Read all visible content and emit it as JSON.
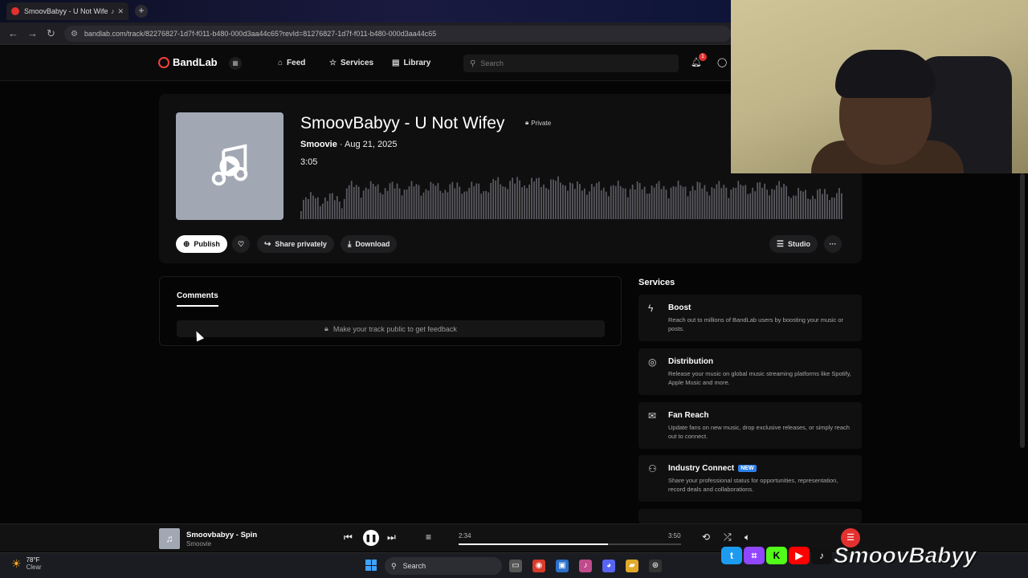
{
  "browser": {
    "tab_title": "SmoovBabyy - U Not Wife",
    "new_tab_symbol": "+",
    "url": "bandlab.com/track/82276827-1d7f-f011-b480-000d3aa44c65?revId=81276827-1d7f-f011-b480-000d3aa44c65"
  },
  "header": {
    "brand": "BandLab",
    "nav": [
      {
        "label": "Feed",
        "icon": "home-icon"
      },
      {
        "label": "Services",
        "icon": "star-icon"
      },
      {
        "label": "Library",
        "icon": "library-icon"
      }
    ],
    "search_placeholder": "Search",
    "notification_count": "1"
  },
  "track": {
    "title": "SmoovBabyy - U Not Wifey",
    "visibility": "Private",
    "artist": "Smoovie",
    "date": "· Aug 21, 2025",
    "duration": "3:05",
    "actions": {
      "publish": "Publish",
      "share": "Share privately",
      "download": "Download",
      "studio": "Studio",
      "more": "···"
    }
  },
  "comments": {
    "tab": "Comments",
    "locked_message": "Make your track public to get feedback"
  },
  "services": {
    "title": "Services",
    "items": [
      {
        "name": "Boost",
        "icon": "bolt-icon",
        "badge": "",
        "desc": "Reach out to millions of BandLab users by boosting your music or posts."
      },
      {
        "name": "Distribution",
        "icon": "globe-icon",
        "badge": "",
        "desc": "Release your music on global music streaming platforms like Spotify, Apple Music and more."
      },
      {
        "name": "Fan Reach",
        "icon": "mail-icon",
        "badge": "",
        "desc": "Update fans on new music, drop exclusive releases, or simply reach out to connect."
      },
      {
        "name": "Industry Connect",
        "icon": "people-icon",
        "badge": "NEW",
        "desc": "Share your professional status for opportunities, representation, record deals and collaborations."
      }
    ]
  },
  "player": {
    "title": "Smoovbabyy - Spin",
    "artist": "Smoovie",
    "elapsed": "2:34",
    "total": "3:50",
    "progress": 0.67
  },
  "taskbar": {
    "temp": "78°F",
    "condition": "Clear",
    "search": "Search"
  },
  "overlay": {
    "brand": "SmoovBabyy"
  },
  "colors": {
    "accent": "#e3312f",
    "new_badge": "#2d7ee6"
  }
}
